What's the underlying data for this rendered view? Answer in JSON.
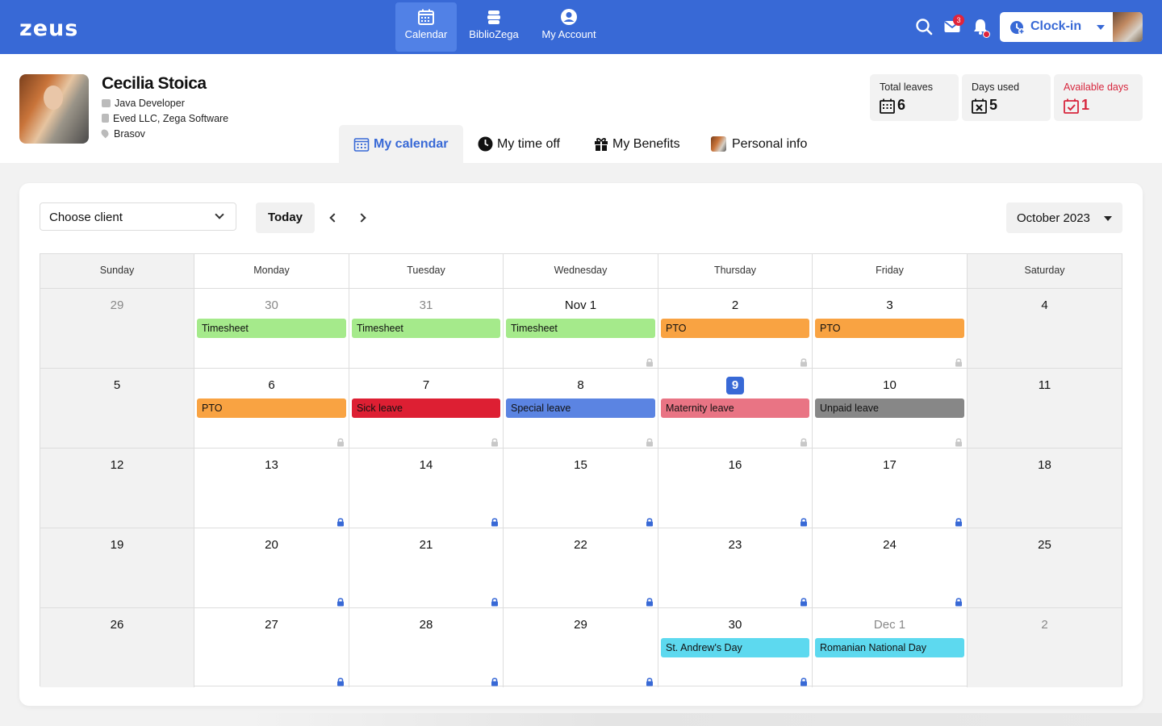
{
  "app": {
    "logo": "zeus"
  },
  "nav": {
    "calendar": "Calendar",
    "biblio": "BiblioZega",
    "account": "My Account"
  },
  "header": {
    "mail_badge": "3",
    "clockin_label": "Clock-in"
  },
  "profile": {
    "name": "Cecilia Stoica",
    "role": "Java Developer",
    "company": "Eved LLC, Zega Software",
    "location": "Brasov"
  },
  "stats": {
    "total_label": "Total leaves",
    "total_value": "6",
    "used_label": "Days used",
    "used_value": "5",
    "available_label": "Available days",
    "available_value": "1"
  },
  "tabs": {
    "calendar": "My calendar",
    "timeoff": "My time off",
    "benefits": "My Benefits",
    "personal": "Personal info"
  },
  "toolbar": {
    "client_placeholder": "Choose client",
    "today": "Today",
    "month": "October 2023"
  },
  "calendar": {
    "weekdays": [
      "Sunday",
      "Monday",
      "Tuesday",
      "Wednesday",
      "Thursday",
      "Friday",
      "Saturday"
    ],
    "weeks": [
      [
        {
          "day": "29",
          "muted": true
        },
        {
          "day": "30",
          "muted": true,
          "event": "Timesheet",
          "color": "#a5ea8b"
        },
        {
          "day": "31",
          "muted": true,
          "event": "Timesheet",
          "color": "#a5ea8b"
        },
        {
          "day": "Nov 1",
          "event": "Timesheet",
          "color": "#a5ea8b",
          "lock": "grey"
        },
        {
          "day": "2",
          "event": "PTO",
          "color": "#f9a342",
          "lock": "grey"
        },
        {
          "day": "3",
          "event": "PTO",
          "color": "#f9a342",
          "lock": "grey"
        },
        {
          "day": "4"
        }
      ],
      [
        {
          "day": "5"
        },
        {
          "day": "6",
          "event": "PTO",
          "color": "#f9a342",
          "lock": "grey"
        },
        {
          "day": "7",
          "event": "Sick leave",
          "color": "#dd1f33",
          "lock": "grey"
        },
        {
          "day": "8",
          "event": "Special leave",
          "color": "#5b84e2",
          "lock": "grey"
        },
        {
          "day": "9",
          "today": true,
          "event": "Maternity leave",
          "color": "#e97484",
          "lock": "grey"
        },
        {
          "day": "10",
          "event": "Unpaid leave",
          "color": "#878787",
          "lock": "grey"
        },
        {
          "day": "11"
        }
      ],
      [
        {
          "day": "12"
        },
        {
          "day": "13",
          "lock": "blue"
        },
        {
          "day": "14",
          "lock": "blue"
        },
        {
          "day": "15",
          "lock": "blue"
        },
        {
          "day": "16",
          "lock": "blue"
        },
        {
          "day": "17",
          "lock": "blue"
        },
        {
          "day": "18"
        }
      ],
      [
        {
          "day": "19"
        },
        {
          "day": "20",
          "lock": "blue"
        },
        {
          "day": "21",
          "lock": "blue"
        },
        {
          "day": "22",
          "lock": "blue"
        },
        {
          "day": "23",
          "lock": "blue"
        },
        {
          "day": "24",
          "lock": "blue"
        },
        {
          "day": "25"
        }
      ],
      [
        {
          "day": "26"
        },
        {
          "day": "27",
          "lock": "blue"
        },
        {
          "day": "28",
          "lock": "blue"
        },
        {
          "day": "29",
          "lock": "blue"
        },
        {
          "day": "30",
          "event": "St. Andrew's Day",
          "color": "#5dd9ef",
          "lock": "blue"
        },
        {
          "day": "Dec 1",
          "muted": true,
          "event": "Romanian National Day",
          "color": "#5dd9ef"
        },
        {
          "day": "2",
          "muted": true
        }
      ]
    ]
  },
  "colors": {
    "brand": "#3869d6",
    "danger": "#d7263d"
  }
}
